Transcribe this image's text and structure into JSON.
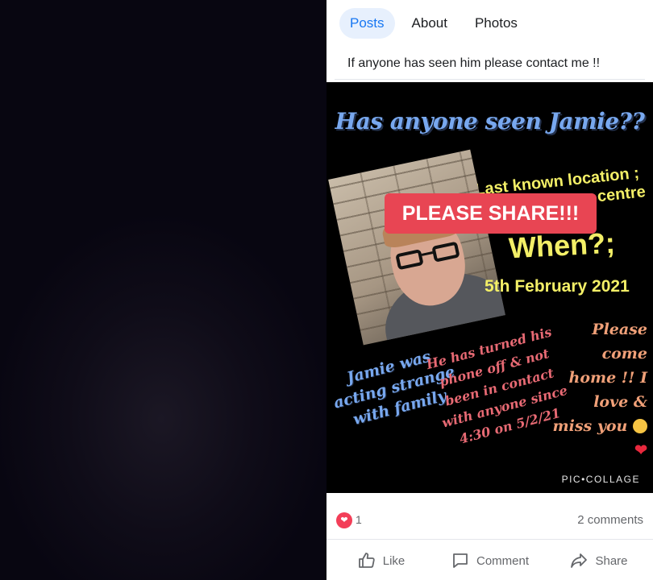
{
  "tabs": [
    {
      "label": "Posts",
      "active": true
    },
    {
      "label": "About",
      "active": false
    },
    {
      "label": "Photos",
      "active": false
    }
  ],
  "post": {
    "text_line": "If anyone has seen him please contact me !!"
  },
  "image": {
    "title": "Has anyone seen Jamie??",
    "location_line1": "Last known location ;",
    "location_line2": "centre",
    "share_badge": "PLEASE SHARE!!!",
    "when": "When?;",
    "date": "5th February 2021",
    "blue_text": "Jamie was acting strange with family",
    "pink_text": "He has turned his phone off & not been in contact with anyone since 4:30 on 5/2/21",
    "orange_text": "Please come home !! I love & miss you",
    "watermark": "PIC•COLLAGE"
  },
  "reactions": {
    "count": "1",
    "comments": "2 comments"
  },
  "actions": {
    "like": "Like",
    "comment": "Comment",
    "share": "Share"
  },
  "colors": {
    "accent": "#1877f2",
    "badge": "#e84553",
    "title_blue": "#78a8ef",
    "yellow": "#f3ef67"
  }
}
